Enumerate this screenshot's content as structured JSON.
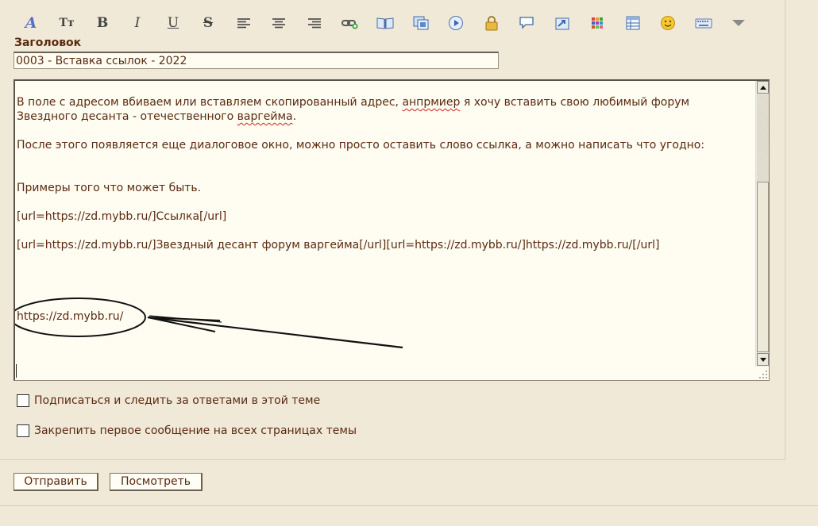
{
  "toolbar": {
    "buttons": [
      {
        "name": "font-color-icon",
        "glyph": "A"
      },
      {
        "name": "font-size-icon",
        "glyph": "Tт"
      },
      {
        "name": "bold-icon",
        "glyph": "B"
      },
      {
        "name": "italic-icon",
        "glyph": "I"
      },
      {
        "name": "underline-icon",
        "glyph": "U"
      },
      {
        "name": "strikethrough-icon",
        "glyph": "S"
      },
      {
        "name": "align-left-icon"
      },
      {
        "name": "align-center-icon"
      },
      {
        "name": "align-right-icon"
      },
      {
        "name": "insert-link-icon"
      },
      {
        "name": "book-icon"
      },
      {
        "name": "insert-image-icon"
      },
      {
        "name": "insert-video-icon"
      },
      {
        "name": "lock-icon"
      },
      {
        "name": "speech-bubble-icon"
      },
      {
        "name": "quote-icon"
      },
      {
        "name": "color-palette-icon"
      },
      {
        "name": "table-icon"
      },
      {
        "name": "smiley-icon"
      },
      {
        "name": "keyboard-icon"
      },
      {
        "name": "more-dropdown-icon"
      }
    ]
  },
  "subject": {
    "label": "Заголовок",
    "value": "0003 - Вставка ссылок - 2022"
  },
  "editor": {
    "lines": [
      {
        "pre": "В поле с адресом вбиваем или вставляем скопированный адрес, ",
        "typo": "анпрмиер",
        "post": " я хочу вставить свою любимый форум"
      },
      {
        "pre": "Звездного десанта - отечественного ",
        "typo": "варгейма",
        "post": "."
      },
      {
        "text": "После этого появляется еще диалоговое окно, можно просто оставить слово ссылка, а можно написать что угодно:"
      },
      {
        "text": "Примеры того что может быть."
      },
      {
        "text": "[url=https://zd.mybb.ru/]Ссылка[/url]"
      },
      {
        "text": "[url=https://zd.mybb.ru/]Звездный десант форум варгейма[/url][url=https://zd.mybb.ru/]https://zd.mybb.ru/[/url]"
      },
      {
        "text": "https://zd.mybb.ru/"
      }
    ]
  },
  "options": {
    "subscribe_label": "Подписаться и следить за ответами в этой теме",
    "pin_label": "Закрепить первое сообщение на всех страницах темы"
  },
  "actions": {
    "submit_label": "Отправить",
    "preview_label": "Посмотреть"
  },
  "colors": {
    "background": "#f1e9d8",
    "text": "#5a2a10",
    "editor_bg": "#fffdf2"
  }
}
